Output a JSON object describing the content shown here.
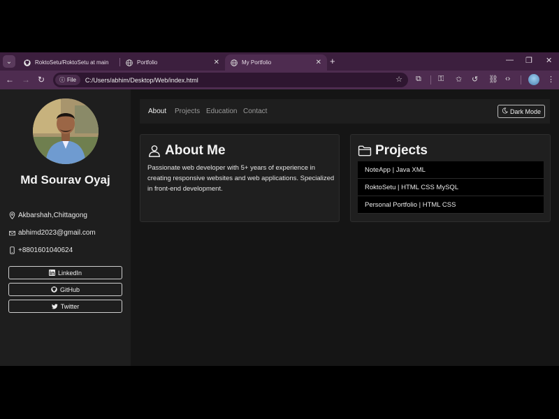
{
  "browser": {
    "tabs": [
      {
        "title": "RoktoSetu/RoktoSetu at main",
        "icon": "github-icon",
        "active": false
      },
      {
        "title": "Portfolio",
        "icon": "globe-icon",
        "active": false
      },
      {
        "title": "My Portfolio",
        "icon": "globe-icon",
        "active": true
      }
    ],
    "address": {
      "chip_label": "File",
      "url": "C:/Users/abhim/Desktop/Web/index.html"
    }
  },
  "sidebar": {
    "name": "Md Sourav Oyaj",
    "contacts": [
      {
        "icon": "location-pin-icon",
        "text": "Akbarshah,Chittagong"
      },
      {
        "icon": "envelope-icon",
        "text": "abhimd2023@gmail.com"
      },
      {
        "icon": "phone-icon",
        "text": "+8801601040624"
      }
    ],
    "socials": [
      {
        "icon": "linkedin-icon",
        "label": "LinkedIn"
      },
      {
        "icon": "github-icon",
        "label": "GitHub"
      },
      {
        "icon": "twitter-icon",
        "label": "Twitter"
      }
    ]
  },
  "navbar": {
    "links": [
      "About",
      "Projects",
      "Education",
      "Contact"
    ],
    "active": "About",
    "dark_mode_label": "Dark Mode"
  },
  "about": {
    "title": "About Me",
    "text": "Passionate web developer with 5+ years of experience in creating responsive websites and web applications. Specialized in front-end development."
  },
  "projects": {
    "title": "Projects",
    "items": [
      "NoteApp | Java XML",
      "RoktoSetu | HTML CSS MySQL",
      "Personal Portfolio | HTML CSS"
    ]
  },
  "colors": {
    "browser_frame": "#3c1f3e",
    "page_bg": "#151515",
    "card_bg": "#1f1f1f",
    "accent_text": "#f2f2f2"
  }
}
